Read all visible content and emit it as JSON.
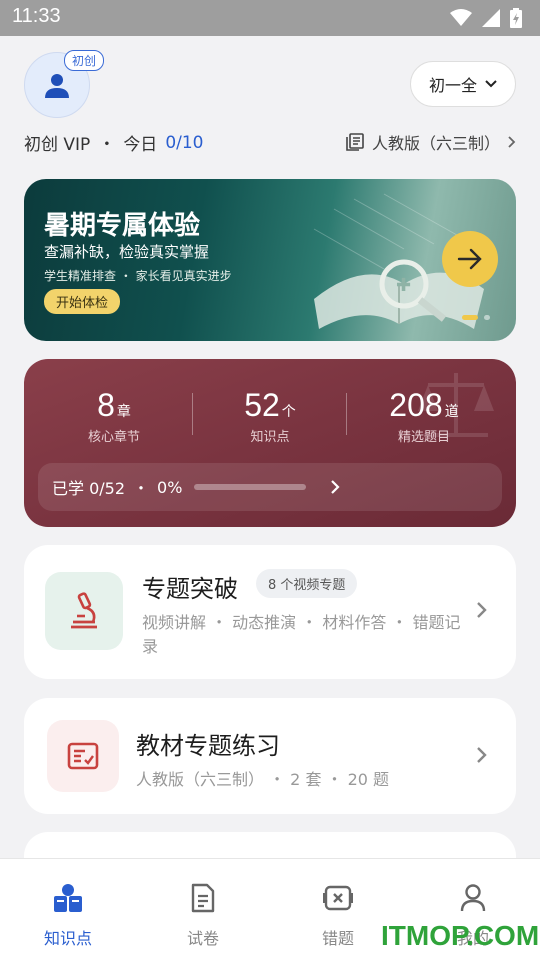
{
  "status_bar": {
    "time": "11:33"
  },
  "header": {
    "avatar_badge": "初创",
    "vip_label": "初创 VIP",
    "today_label": "今日",
    "today_count": "0/10",
    "grade_select": "初一全",
    "edition": "人教版（六三制）"
  },
  "banner": {
    "title": "暑期专属体验",
    "subtitle": "查漏补缺，检验真实掌握",
    "small_left": "学生精准排查",
    "small_right": "家长看见真实进步",
    "cta": "开始体检"
  },
  "stats": {
    "items": [
      {
        "value": "8",
        "unit": "章",
        "label": "核心章节"
      },
      {
        "value": "52",
        "unit": "个",
        "label": "知识点"
      },
      {
        "value": "208",
        "unit": "道",
        "label": "精选题目"
      }
    ],
    "learned_label": "已学 0/52",
    "percent_label": "0%",
    "progress_fraction": 0
  },
  "cards": {
    "topic": {
      "title": "专题突破",
      "tag": "8 个视频专题",
      "desc": "视频讲解 ・ 动态推演 ・ 材料作答 ・ 错题记录"
    },
    "textbook": {
      "title": "教材专题练习",
      "desc": "人教版（六三制） ・ 2 套 ・ 20 题"
    }
  },
  "tabs": [
    {
      "label": "知识点",
      "icon": "knowledge-icon",
      "active": true
    },
    {
      "label": "试卷",
      "icon": "paper-icon",
      "active": false
    },
    {
      "label": "错题",
      "icon": "wrong-question-icon",
      "active": false
    },
    {
      "label": "我的",
      "icon": "user-icon",
      "active": false
    }
  ],
  "watermark": "ITMOP.COM",
  "colors": {
    "accent": "#2a5ecf",
    "stats_bg": "#7a3440",
    "banner_cta": "#f2d36b"
  }
}
